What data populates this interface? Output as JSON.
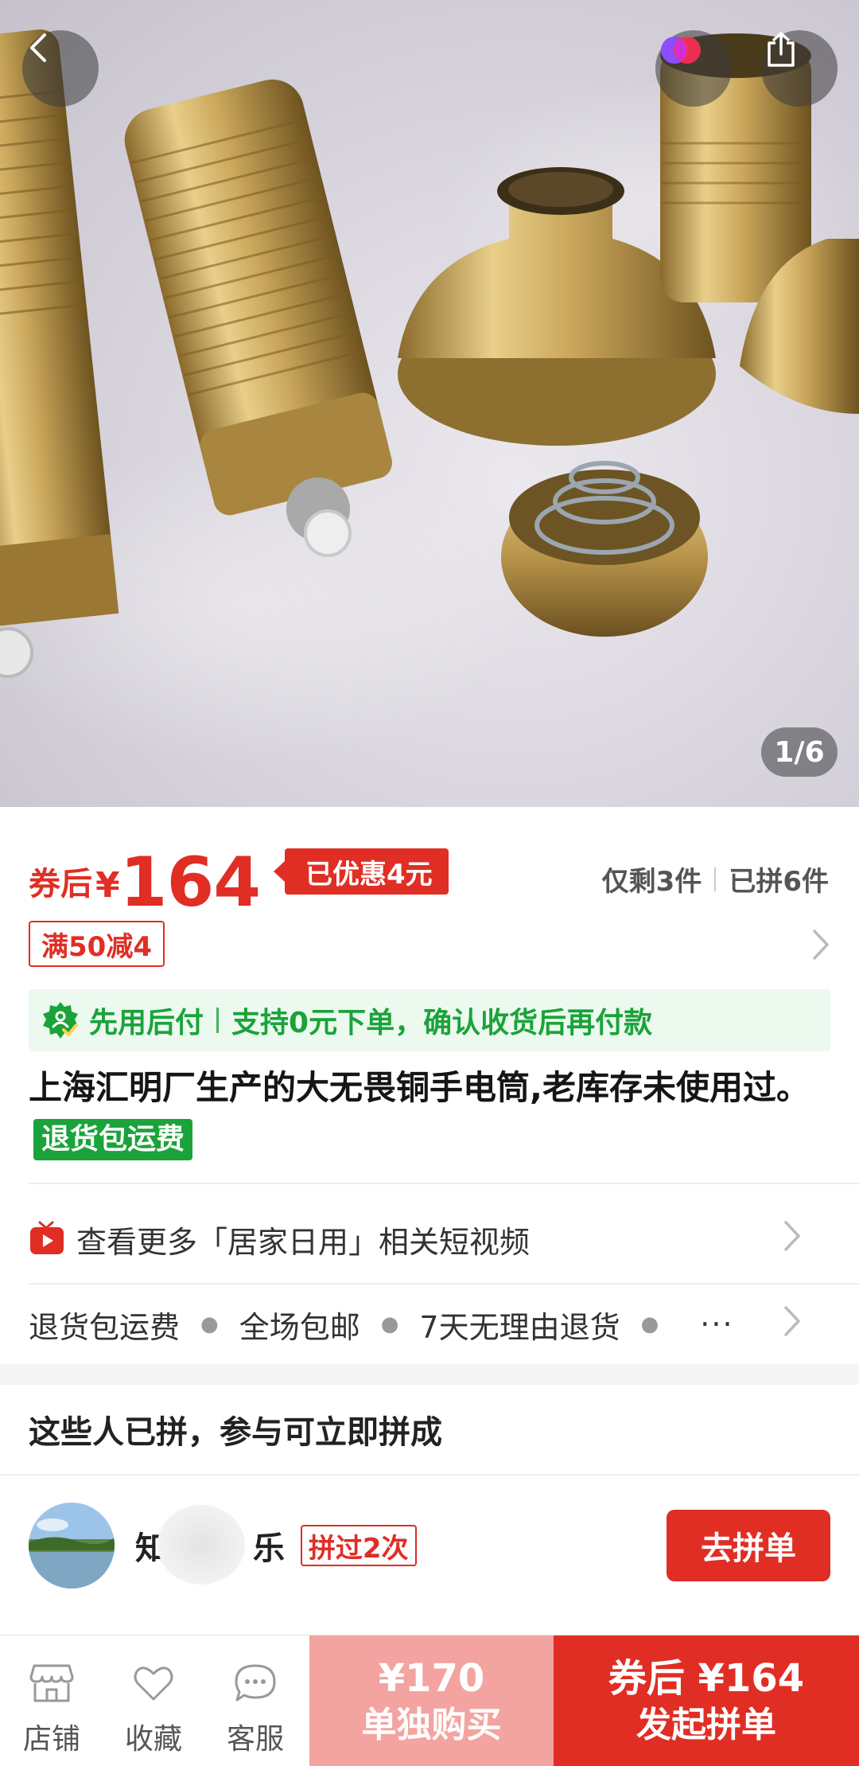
{
  "hero": {
    "image_counter": "1/6",
    "icons": {
      "back": "chevron-left-icon",
      "brand": "brand-logo-icon",
      "share": "share-icon"
    }
  },
  "price": {
    "prefix": "券后",
    "currency": "¥",
    "amount": "164",
    "discount_tag": "已优惠4元",
    "stock_left": "仅剩3件",
    "sold_count": "已拼6件",
    "accent_color": "#e02e24"
  },
  "coupon": {
    "label": "满50减4"
  },
  "pay_later": {
    "label": "先用后付",
    "detail": "支持0元下单，确认收货后再付款",
    "color": "#1aa33a"
  },
  "product": {
    "title": "上海汇明厂生产的大无畏铜手电筒,老库存未使用过。",
    "badge": "退货包运费"
  },
  "video_link": {
    "label": "查看更多「居家日用」相关短视频"
  },
  "services": {
    "items": [
      "退货包运费",
      "全场包邮",
      "7天无理由退货"
    ],
    "more": "···"
  },
  "group_buy": {
    "heading": "这些人已拼，参与可立即拼成",
    "member": {
      "name_start": "知",
      "name_end": "乐",
      "joined_badge": "拼过2次",
      "join_button": "去拼单"
    }
  },
  "bottom_bar": {
    "nav": [
      {
        "label": "店铺",
        "icon": "store-icon"
      },
      {
        "label": "收藏",
        "icon": "heart-icon"
      },
      {
        "label": "客服",
        "icon": "chat-icon"
      }
    ],
    "single_buy": {
      "price": "¥170",
      "label": "单独购买"
    },
    "group_buy": {
      "price": "券后 ¥164",
      "label": "发起拼单"
    }
  }
}
